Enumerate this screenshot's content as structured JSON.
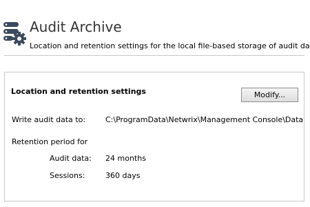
{
  "header": {
    "icon": "server-gear-icon",
    "title": "Audit Archive",
    "subtitle": "Location and retention settings for the local file-based storage of audit data."
  },
  "panel": {
    "heading": "Location and retention settings",
    "modify_label": "Modify...",
    "write_label": "Write audit data to:",
    "write_value": "C:\\ProgramData\\Netwrix\\Management Console\\Data",
    "retention_label": "Retention period for",
    "audit_label": "Audit data:",
    "audit_value": "24 months",
    "sessions_label": "Sessions:",
    "sessions_value": "360 days"
  },
  "colors": {
    "icon": "#3c4a5e",
    "divider": "#c8c8c8",
    "title": "#333333"
  }
}
